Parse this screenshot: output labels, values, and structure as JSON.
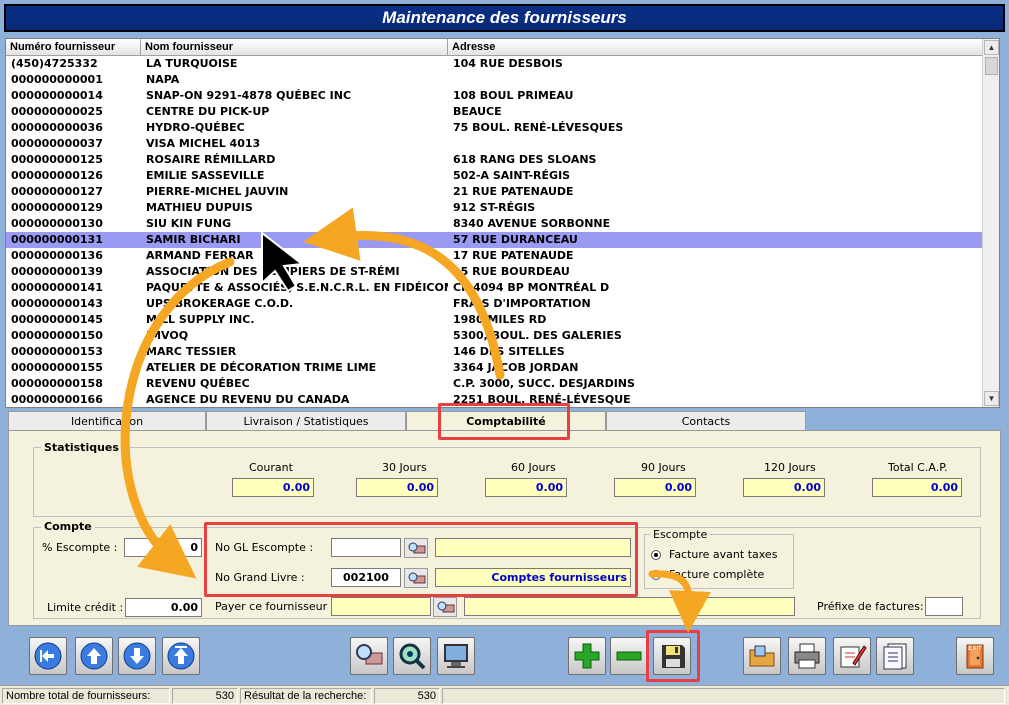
{
  "window": {
    "title": "Maintenance des fournisseurs"
  },
  "grid": {
    "columns": [
      "Numéro fournisseur",
      "Nom fournisseur",
      "Adresse"
    ],
    "selected_index": 11,
    "rows": [
      [
        "(450)4725332",
        "LA TURQUOISE",
        "104 RUE DESBOIS"
      ],
      [
        "000000000001",
        "NAPA",
        ""
      ],
      [
        "000000000014",
        "SNAP-ON 9291-4878 QUÉBEC INC",
        "108 BOUL PRIMEAU"
      ],
      [
        "000000000025",
        "CENTRE DU PICK-UP",
        "BEAUCE"
      ],
      [
        "000000000036",
        "HYDRO-QUÉBEC",
        "75 BOUL. RENÉ-LÉVESQUES"
      ],
      [
        "000000000037",
        "VISA MICHEL 4013",
        ""
      ],
      [
        "000000000125",
        "ROSAIRE RÉMILLARD",
        "618 RANG DES SLOANS"
      ],
      [
        "000000000126",
        "EMILIE SASSEVILLE",
        "502-A SAINT-RÉGIS"
      ],
      [
        "000000000127",
        "PIERRE-MICHEL JAUVIN",
        "21 RUE PATENAUDE"
      ],
      [
        "000000000129",
        "MATHIEU DUPUIS",
        "912 ST-RÉGIS"
      ],
      [
        "000000000130",
        "SIU KIN FUNG",
        "8340 AVENUE SORBONNE"
      ],
      [
        "000000000131",
        "SAMIR BICHARI",
        "57 RUE DURANCEAU"
      ],
      [
        "000000000136",
        "ARMAND FERRAR",
        "17 RUE PATENAUDE"
      ],
      [
        "000000000139",
        "ASSOCIATION DES POMPIERS DE ST-RÉMI",
        "15 RUE BOURDEAU"
      ],
      [
        "000000000141",
        "PAQUETTE & ASSOCIÉS, S.E.N.C.R.L. EN FIDÉICOMMIS",
        "CP 4094 BP MONTRÉAL D"
      ],
      [
        "000000000143",
        "UPS BROKERAGE C.O.D.",
        "FRAIS D'IMPORTATION"
      ],
      [
        "000000000145",
        "MILL SUPPLY INC.",
        "1980 MILES RD"
      ],
      [
        "000000000150",
        "JMVOQ",
        "5300, BOUL. DES GALERIES"
      ],
      [
        "000000000153",
        "MARC TESSIER",
        "146 DES SITELLES"
      ],
      [
        "000000000155",
        "ATELIER DE DÉCORATION TRIME LIME",
        "3364 JACOB JORDAN"
      ],
      [
        "000000000158",
        "REVENU QUÉBEC",
        "C.P. 3000, SUCC. DESJARDINS"
      ],
      [
        "000000000166",
        "AGENCE DU REVENU DU CANADA",
        "2251 BOUL. RENÉ-LÉVESQUE"
      ]
    ]
  },
  "tabs": [
    {
      "label": "Identification"
    },
    {
      "label": "Livraison / Statistiques"
    },
    {
      "label": "Comptabilité"
    },
    {
      "label": "Contacts"
    }
  ],
  "stats": {
    "title": "Statistiques",
    "items": [
      {
        "label": "Courant",
        "value": "0.00"
      },
      {
        "label": "30 Jours",
        "value": "0.00"
      },
      {
        "label": "60 Jours",
        "value": "0.00"
      },
      {
        "label": "90 Jours",
        "value": "0.00"
      },
      {
        "label": "120 Jours",
        "value": "0.00"
      },
      {
        "label": "Total C.A.P.",
        "value": "0.00"
      }
    ]
  },
  "compte": {
    "title": "Compte",
    "escompte_label": "% Escompte :",
    "escompte_value": "0",
    "limite_label": "Limite crédit :",
    "limite_value": "0.00",
    "gl_escompte_label": "No GL Escompte :",
    "gl_escompte_value": "",
    "gl_escompte_desc": "",
    "grand_livre_label": "No Grand Livre :",
    "grand_livre_value": "002100",
    "grand_livre_desc": "Comptes fournisseurs",
    "payer_label": "Payer ce fournisseur :",
    "payer_value": "",
    "payer_desc": "",
    "prefixe_label": "Préfixe de factures:",
    "prefixe_value": ""
  },
  "escompte_group": {
    "title": "Escompte",
    "options": [
      "Facture avant taxes",
      "Facture complète"
    ],
    "selected": 0
  },
  "toolbar": {
    "icons": [
      "first-record-icon",
      "previous-record-icon",
      "next-record-icon",
      "last-record-icon",
      "search-icon",
      "zoom-search-icon",
      "display-icon",
      "add-icon",
      "delete-icon",
      "save-icon",
      "open-folder-icon",
      "print-icon",
      "edit-note-icon",
      "report-icon",
      "exit-icon"
    ],
    "exit_label": "EXIT"
  },
  "statusbar": {
    "total_label": "Nombre total de fournisseurs:",
    "total_value": "530",
    "result_label": "Résultat de la recherche:",
    "result_value": "530"
  },
  "colors": {
    "title_bg": "#0a2e86",
    "selection": "#9a9af2",
    "highlight": "#e84040",
    "arrow": "#f5a623",
    "field_yellow": "#ffffbe"
  }
}
